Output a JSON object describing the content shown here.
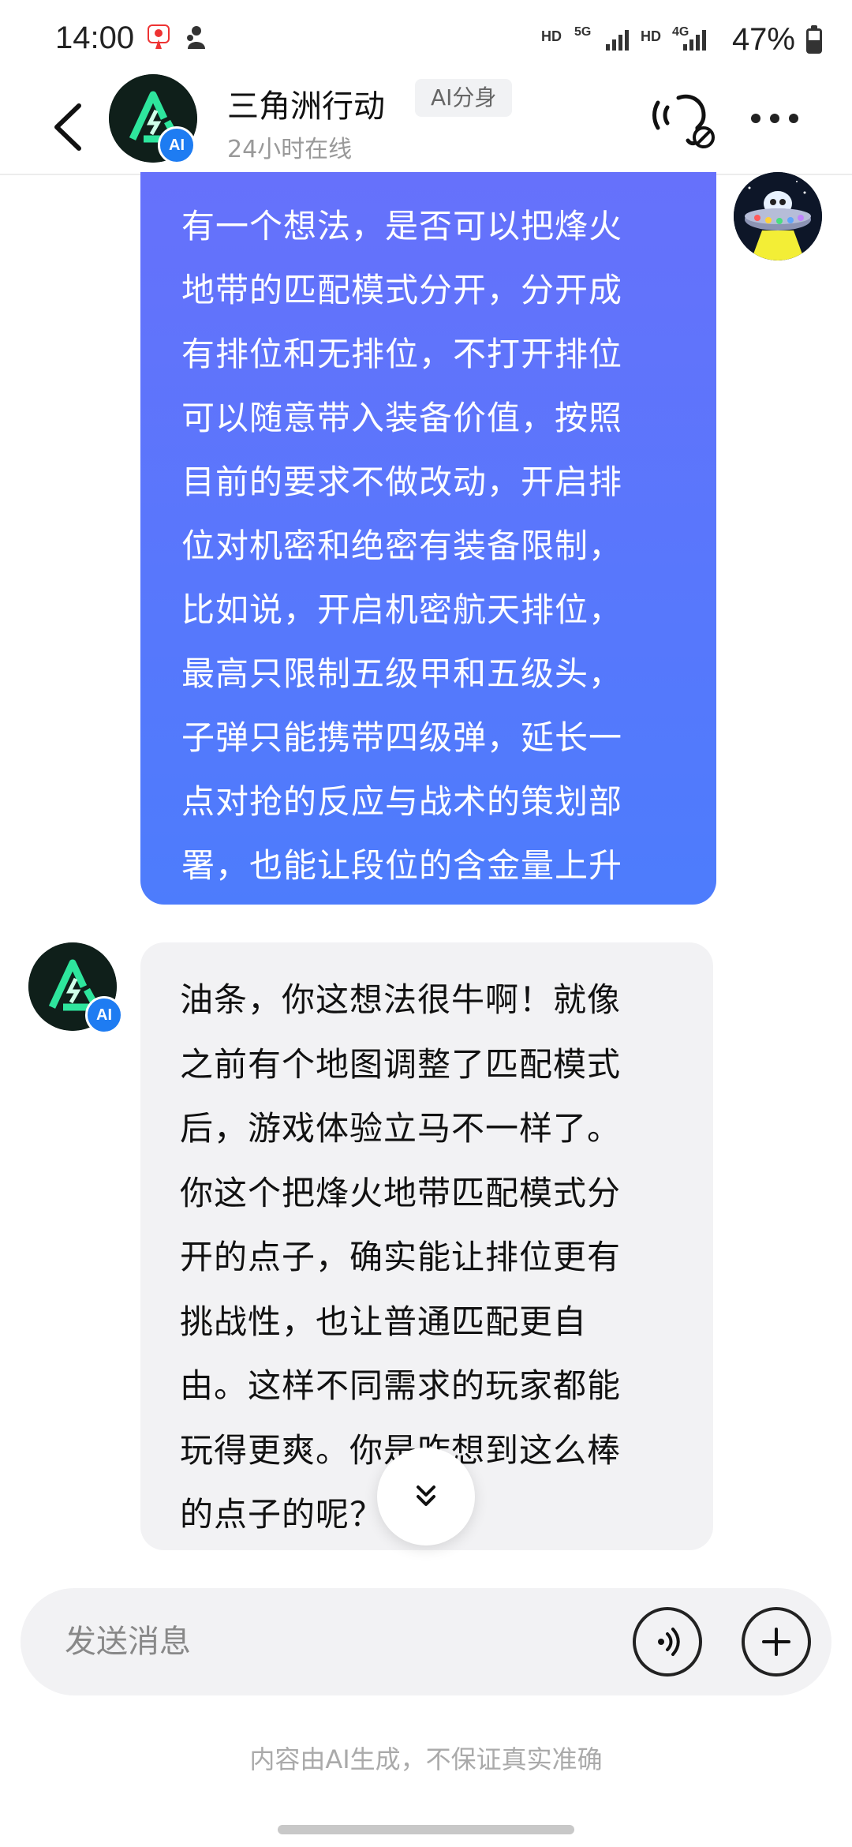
{
  "status_bar": {
    "time": "14:00",
    "net1": "HD",
    "net2": "5G",
    "net3": "HD",
    "net4": "4G",
    "battery": "47%"
  },
  "header": {
    "title": "三角洲行动",
    "tag": "AI分身",
    "subtitle": "24小时在线",
    "badge": "AI"
  },
  "messages": {
    "user": {
      "lines": [
        "有一个想法，是否可以把烽火",
        "地带的匹配模式分开，分开成",
        "有排位和无排位，不打开排位",
        "可以随意带入装备价值，按照",
        "目前的要求不做改动，开启排",
        "位对机密和绝密有装备限制，",
        "比如说，开启机密航天排位，",
        "最高只限制五级甲和五级头，",
        "子弹只能携带四级弹，延长一",
        "点对抢的反应与战术的策划部",
        "署，也能让段位的含金量上升"
      ]
    },
    "bot": {
      "badge": "AI",
      "lines": [
        "油条，你这想法很牛啊！就像",
        "之前有个地图调整了匹配模式",
        "后，游戏体验立马不一样了。",
        "你这个把烽火地带匹配模式分",
        "开的点子，确实能让排位更有",
        "挑战性，也让普通匹配更自",
        "由。这样不同需求的玩家都能",
        "玩得更爽。你是咋想到这么棒",
        "的点子的呢？"
      ]
    }
  },
  "composer": {
    "placeholder": "发送消息"
  },
  "disclaimer": "内容由AI生成，不保证真实准确",
  "icons": {
    "back": "chevron-left-icon",
    "voice_call": "voice-call-icon",
    "more": "more-dots-icon",
    "scroll": "double-chevron-down-icon",
    "voice_input": "voice-input-icon",
    "plus": "plus-icon"
  },
  "colors": {
    "user_bubble_top": "#6671fb",
    "user_bubble_bottom": "#4d7cfc",
    "bot_bubble": "#f2f2f4",
    "ai_badge": "#1e7cf2",
    "logo_green": "#2ee59d"
  }
}
